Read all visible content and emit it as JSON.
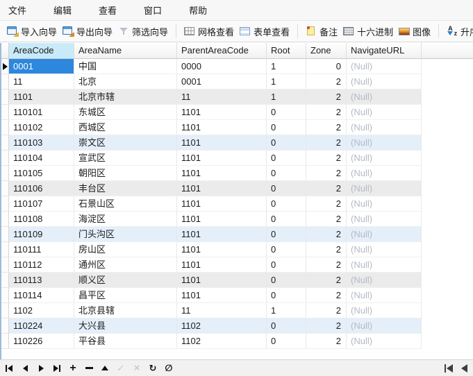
{
  "menu": {
    "items": [
      {
        "label": "文件"
      },
      {
        "label": "编辑"
      },
      {
        "label": "查看"
      },
      {
        "label": "窗口"
      },
      {
        "label": "帮助"
      }
    ]
  },
  "toolbar": {
    "items": [
      {
        "label": "导入向导",
        "icon": "import-wizard-icon"
      },
      {
        "label": "导出向导",
        "icon": "export-wizard-icon"
      },
      {
        "label": "筛选向导",
        "icon": "filter-wizard-icon"
      },
      {
        "label": "网格查看",
        "icon": "grid-view-icon"
      },
      {
        "label": "表单查看",
        "icon": "form-view-icon"
      },
      {
        "label": "备注",
        "icon": "memo-icon"
      },
      {
        "label": "十六进制",
        "icon": "hex-icon"
      },
      {
        "label": "图像",
        "icon": "image-icon"
      },
      {
        "label": "升序排序",
        "icon": "sort-ascending-icon"
      }
    ]
  },
  "grid": {
    "columns": [
      {
        "label": "AreaCode"
      },
      {
        "label": "AreaName"
      },
      {
        "label": "ParentAreaCode"
      },
      {
        "label": "Root"
      },
      {
        "label": "Zone"
      },
      {
        "label": "NavigateURL"
      }
    ],
    "rows": [
      {
        "code": "0001",
        "name": "中国",
        "parent": "0000",
        "root": "1",
        "zone": "0",
        "url": "(Null)",
        "cls": "current"
      },
      {
        "code": "11",
        "name": "北京",
        "parent": "0001",
        "root": "1",
        "zone": "2",
        "url": "(Null)",
        "cls": ""
      },
      {
        "code": "1101",
        "name": "北京市辖",
        "parent": "11",
        "root": "1",
        "zone": "2",
        "url": "(Null)",
        "cls": "shade-gray"
      },
      {
        "code": "110101",
        "name": "东城区",
        "parent": "1101",
        "root": "0",
        "zone": "2",
        "url": "(Null)",
        "cls": ""
      },
      {
        "code": "110102",
        "name": "西城区",
        "parent": "1101",
        "root": "0",
        "zone": "2",
        "url": "(Null)",
        "cls": ""
      },
      {
        "code": "110103",
        "name": "崇文区",
        "parent": "1101",
        "root": "0",
        "zone": "2",
        "url": "(Null)",
        "cls": "shade-blue"
      },
      {
        "code": "110104",
        "name": "宣武区",
        "parent": "1101",
        "root": "0",
        "zone": "2",
        "url": "(Null)",
        "cls": ""
      },
      {
        "code": "110105",
        "name": "朝阳区",
        "parent": "1101",
        "root": "0",
        "zone": "2",
        "url": "(Null)",
        "cls": ""
      },
      {
        "code": "110106",
        "name": "丰台区",
        "parent": "1101",
        "root": "0",
        "zone": "2",
        "url": "(Null)",
        "cls": "shade-gray"
      },
      {
        "code": "110107",
        "name": "石景山区",
        "parent": "1101",
        "root": "0",
        "zone": "2",
        "url": "(Null)",
        "cls": ""
      },
      {
        "code": "110108",
        "name": "海淀区",
        "parent": "1101",
        "root": "0",
        "zone": "2",
        "url": "(Null)",
        "cls": ""
      },
      {
        "code": "110109",
        "name": "门头沟区",
        "parent": "1101",
        "root": "0",
        "zone": "2",
        "url": "(Null)",
        "cls": "shade-blue"
      },
      {
        "code": "110111",
        "name": "房山区",
        "parent": "1101",
        "root": "0",
        "zone": "2",
        "url": "(Null)",
        "cls": ""
      },
      {
        "code": "110112",
        "name": "通州区",
        "parent": "1101",
        "root": "0",
        "zone": "2",
        "url": "(Null)",
        "cls": ""
      },
      {
        "code": "110113",
        "name": "顺义区",
        "parent": "1101",
        "root": "0",
        "zone": "2",
        "url": "(Null)",
        "cls": "shade-gray"
      },
      {
        "code": "110114",
        "name": "昌平区",
        "parent": "1101",
        "root": "0",
        "zone": "2",
        "url": "(Null)",
        "cls": ""
      },
      {
        "code": "1102",
        "name": "北京县辖",
        "parent": "11",
        "root": "1",
        "zone": "2",
        "url": "(Null)",
        "cls": ""
      },
      {
        "code": "110224",
        "name": "大兴县",
        "parent": "1102",
        "root": "0",
        "zone": "2",
        "url": "(Null)",
        "cls": "shade-blue"
      },
      {
        "code": "110226",
        "name": "平谷县",
        "parent": "1102",
        "root": "0",
        "zone": "2",
        "url": "(Null)",
        "cls": ""
      }
    ]
  },
  "navigator": {
    "icons": [
      "first-record-icon",
      "prior-record-icon",
      "next-record-icon",
      "last-record-icon",
      "insert-record-icon",
      "delete-record-icon",
      "edit-record-icon",
      "post-edit-icon",
      "cancel-edit-icon",
      "refresh-icon",
      "stop-icon",
      "scroll-first-left-icon",
      "scroll-left-icon"
    ],
    "glyphs": {
      "post": "✓",
      "cancel": "×",
      "refresh": "↻",
      "stop": "∅"
    }
  },
  "colors": {
    "selection": "#2c87dd",
    "header_highlight": "#c9eaf9",
    "shade_gray": "#ebebeb",
    "shade_blue": "#e4effa",
    "null_text": "#b4bac3"
  }
}
